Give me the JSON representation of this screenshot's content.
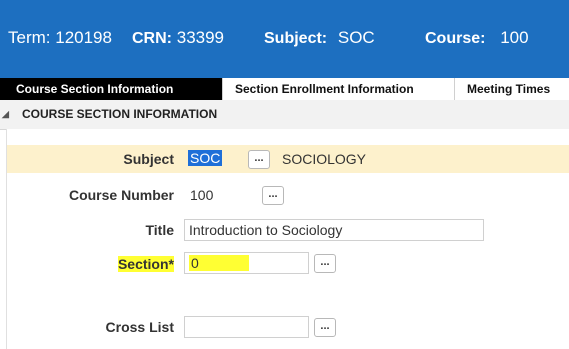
{
  "header": {
    "term_label": "Term:",
    "term_value": "120198",
    "crn_label": "CRN:",
    "crn_value": "33399",
    "subject_label": "Subject:",
    "subject_value": "SOC",
    "course_label": "Course:",
    "course_value": "100"
  },
  "tabs": [
    {
      "label": "Course Section Information"
    },
    {
      "label": "Section Enrollment Information"
    },
    {
      "label": "Meeting Times"
    }
  ],
  "section": {
    "title": "COURSE SECTION INFORMATION"
  },
  "form": {
    "subject": {
      "label": "Subject",
      "code": "SOC",
      "description": "SOCIOLOGY"
    },
    "course_number": {
      "label": "Course Number",
      "value": "100"
    },
    "title": {
      "label": "Title",
      "value": "Introduction to Sociology"
    },
    "section": {
      "label": "Section",
      "required_mark": "*",
      "value": "0"
    },
    "cross_list": {
      "label": "Cross List",
      "value": ""
    },
    "lookup_button_label": "..."
  },
  "colors": {
    "header_bg": "#1d6fc0",
    "active_tab_bg": "#000000",
    "highlight_row": "#fdf1cc",
    "annotation_highlight": "#ffff33"
  }
}
